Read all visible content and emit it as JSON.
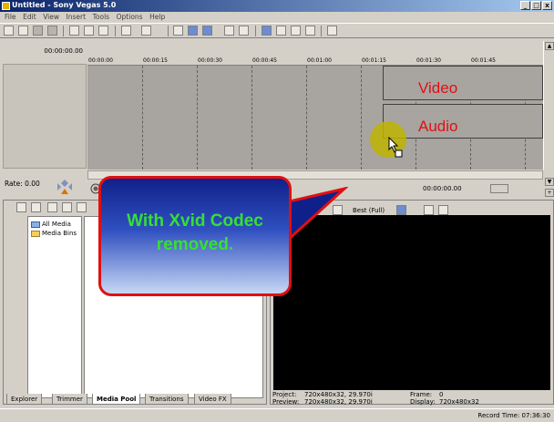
{
  "window": {
    "title": "Untitled - Sony Vegas 5.0",
    "buttons": [
      "_",
      "□",
      "x"
    ]
  },
  "menu": [
    "File",
    "Edit",
    "View",
    "Insert",
    "Tools",
    "Options",
    "Help"
  ],
  "timeline": {
    "cursor_time": "00:00:00.00",
    "ruler_ticks": [
      "00:00:00",
      "00:00:15",
      "00:00:30",
      "00:00:45",
      "00:01:00",
      "00:01:15",
      "00:01:30",
      "00:01:45"
    ],
    "tracks": [
      {
        "label": "Video"
      },
      {
        "label": "Audio"
      }
    ]
  },
  "transport": {
    "rate_label": "Rate: 0.00",
    "timecode": "00:00:00.00"
  },
  "explorer": {
    "tree": [
      {
        "label": "All Media"
      },
      {
        "label": "Media Bins"
      }
    ],
    "tabs": [
      "Explorer",
      "Trimmer",
      "Media Pool",
      "Transitions",
      "Video FX"
    ],
    "active_tab": "Media Pool"
  },
  "preview": {
    "quality": "Best (Full)",
    "project_label": "Project:",
    "project_value": "720x480x32, 29.970i",
    "preview_label": "Preview:",
    "preview_value": "720x480x32, 29.970i",
    "frame_label": "Frame:",
    "frame_value": "0",
    "display_label": "Display:",
    "display_value": "720x480x32"
  },
  "status": {
    "record_time": "Record Time: 07:36:30"
  },
  "callout": {
    "text_line1": "With Xvid Codec",
    "text_line2": "removed."
  },
  "colors": {
    "titlebar_start": "#0a246a",
    "titlebar_end": "#a6caf0",
    "track_label": "#e01010",
    "callout_border": "#e01010",
    "callout_text": "#34e034",
    "preview_bg": "#000000"
  }
}
